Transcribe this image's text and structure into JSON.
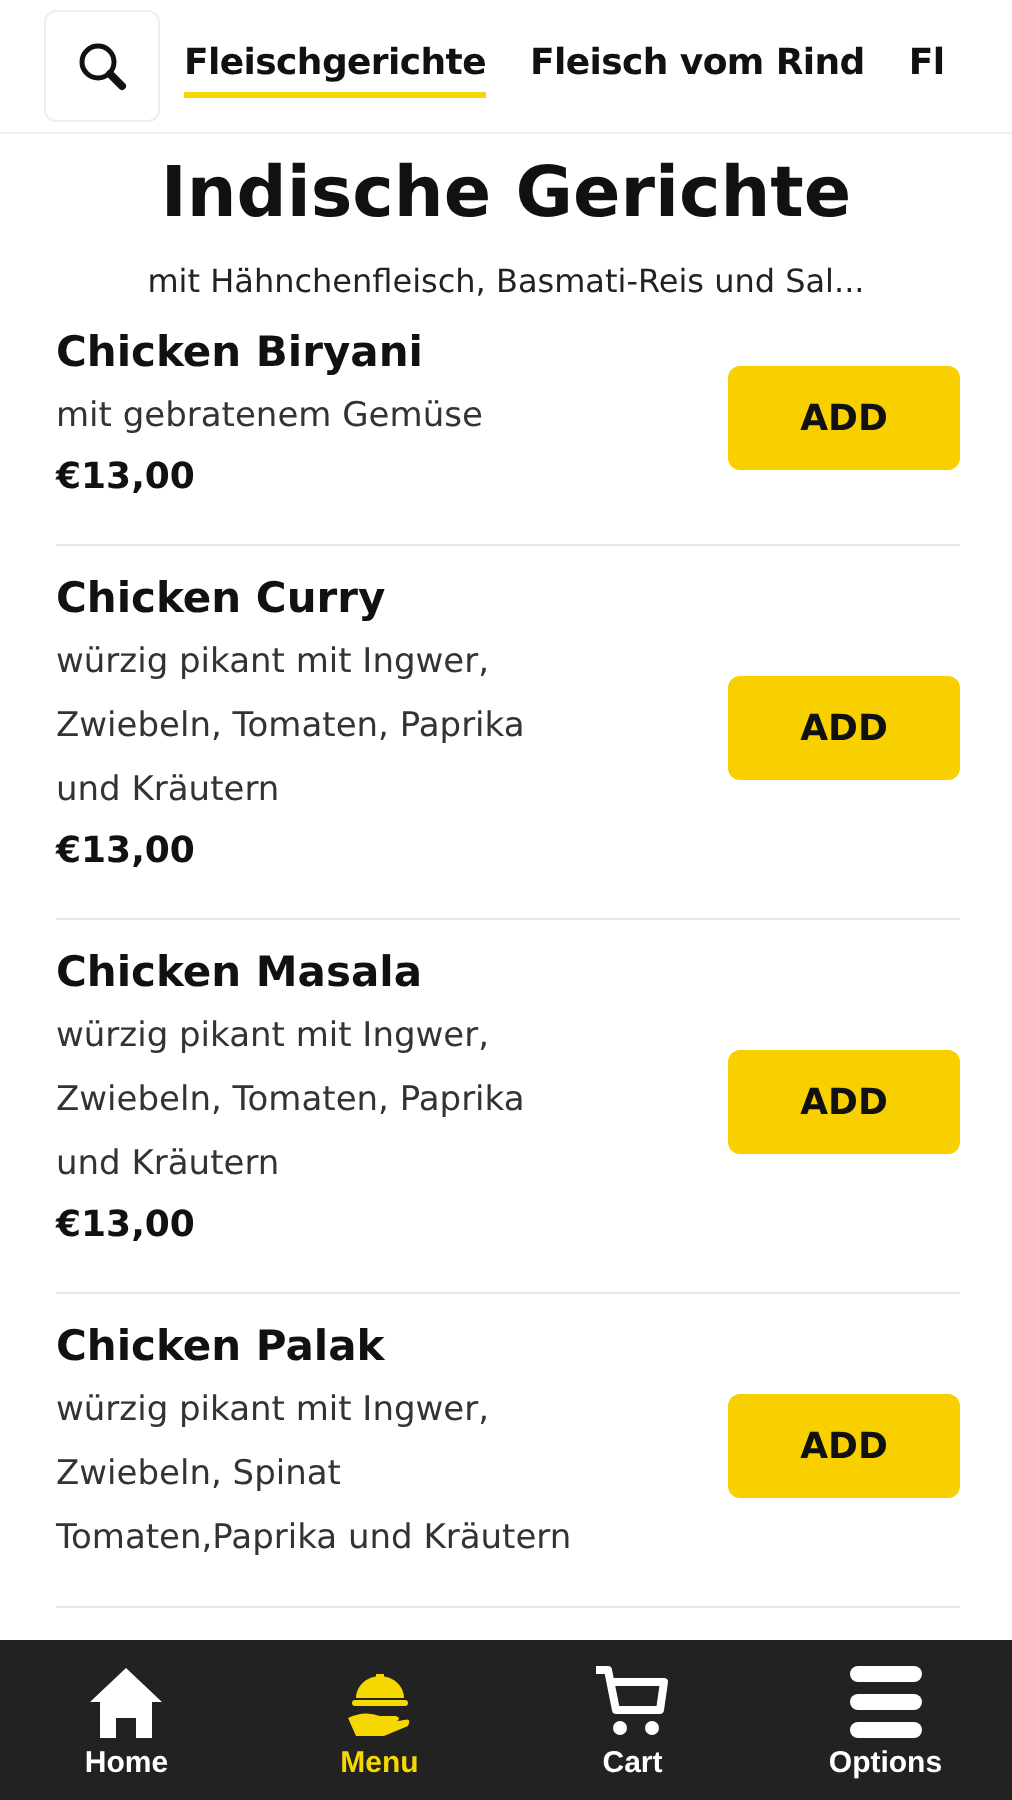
{
  "tabs": [
    {
      "label": "Fleischgerichte",
      "selected": true
    },
    {
      "label": "Fleisch vom Rind",
      "selected": false
    },
    {
      "label": "Fl",
      "selected": false
    }
  ],
  "category": {
    "title": "Indische Gerichte",
    "subtitle": "mit Hähnchenfleisch, Basmati-Reis und Sal..."
  },
  "items": [
    {
      "name": "Chicken Biryani",
      "description": [
        "mit gebratenem Gemüse"
      ],
      "price": "€13,00",
      "button": "ADD"
    },
    {
      "name": "Chicken Curry",
      "description": [
        "würzig pikant mit Ingwer,",
        "Zwiebeln, Tomaten, Paprika",
        "und Kräutern"
      ],
      "price": "€13,00",
      "button": "ADD"
    },
    {
      "name": "Chicken Masala",
      "description": [
        "würzig pikant mit Ingwer,",
        "Zwiebeln, Tomaten, Paprika",
        "und Kräutern"
      ],
      "price": "€13,00",
      "button": "ADD"
    },
    {
      "name": "Chicken Palak",
      "description": [
        "würzig pikant mit Ingwer,",
        "Zwiebeln, Spinat",
        "Tomaten,Paprika und Kräutern"
      ],
      "button": "ADD"
    }
  ],
  "nav": [
    {
      "label": "Home",
      "kind": "home",
      "selected": false
    },
    {
      "label": "Menu",
      "kind": "menu",
      "selected": true
    },
    {
      "label": "Cart",
      "kind": "cart",
      "selected": false
    },
    {
      "label": "Options",
      "kind": "options",
      "selected": false
    }
  ]
}
